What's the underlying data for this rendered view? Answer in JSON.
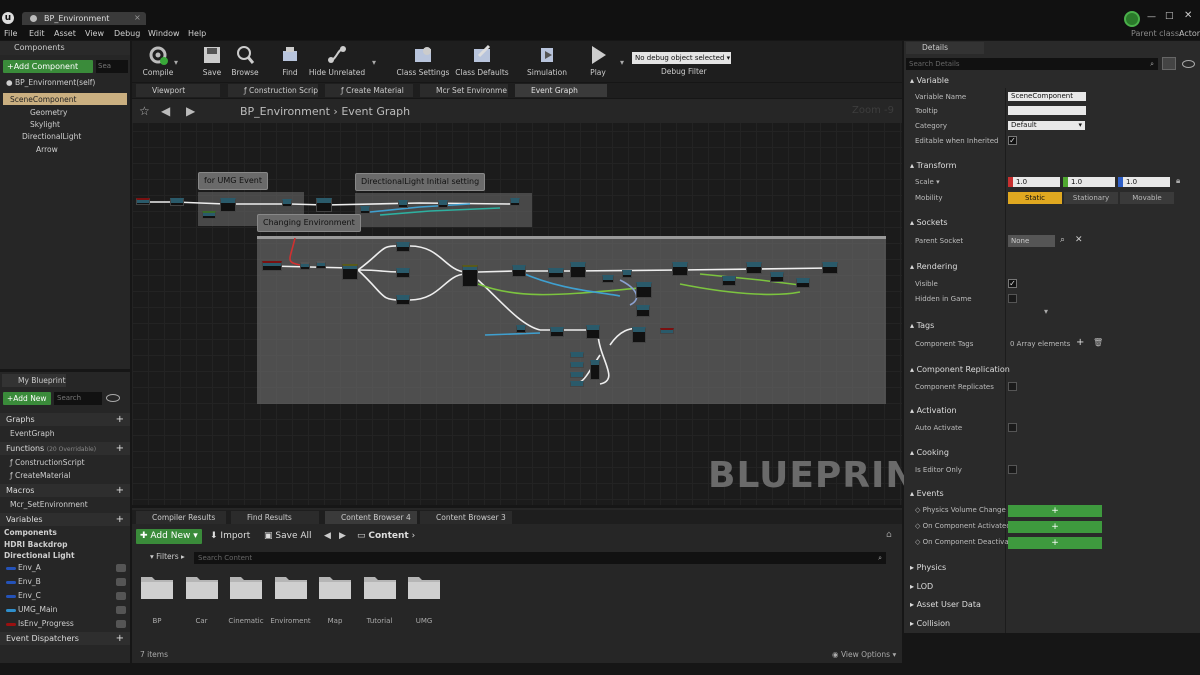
{
  "window": {
    "tab_title": "BP_Environment",
    "parent_class_label": "Parent class:",
    "parent_class_value": "Actor"
  },
  "menu": [
    "File",
    "Edit",
    "Asset",
    "View",
    "Debug",
    "Window",
    "Help"
  ],
  "toolbar": {
    "compile": "Compile",
    "save": "Save",
    "browse": "Browse",
    "find": "Find",
    "hide_unrelated": "Hide Unrelated",
    "class_settings": "Class Settings",
    "class_defaults": "Class Defaults",
    "simulation": "Simulation",
    "play": "Play",
    "debug_select": "No debug object selected",
    "debug_filter": "Debug Filter"
  },
  "components": {
    "header": "Components",
    "add_component": "+Add Component",
    "search_placeholder": "Sea",
    "self_item": "BP_Environment(self)",
    "tree": [
      "SceneComponent",
      "Geometry",
      "Skylight",
      "DirectionalLight",
      "Arrow"
    ]
  },
  "my_blueprint": {
    "header": "My Blueprint",
    "add_new": "+Add New",
    "search_placeholder": "Search",
    "graphs_label": "Graphs",
    "event_graph": "EventGraph",
    "functions_label": "Functions",
    "functions_note": "(20 Overridable)",
    "functions": [
      "ConstructionScript",
      "CreateMaterial"
    ],
    "macros_label": "Macros",
    "macros": [
      "Mcr_SetEnvironment"
    ],
    "variables_label": "Variables",
    "var_groups": [
      "Components",
      "HDRI Backdrop",
      "Directional Light"
    ],
    "variables": [
      {
        "name": "Env_A",
        "color": "#2452b8"
      },
      {
        "name": "Env_B",
        "color": "#2452b8"
      },
      {
        "name": "Env_C",
        "color": "#2452b8"
      },
      {
        "name": "UMG_Main",
        "color": "#2f8fcc"
      },
      {
        "name": "IsEnv_Progress",
        "color": "#9a1010"
      }
    ],
    "dispatchers_label": "Event Dispatchers"
  },
  "editor_tabs": [
    "Viewport",
    "Construction Scrip",
    "Create Material",
    "Mcr Set Environme",
    "Event Graph"
  ],
  "graph": {
    "breadcrumb_root": "BP_Environment",
    "breadcrumb_leaf": "Event Graph",
    "zoom": "Zoom -9",
    "watermark": "BLUEPRINT",
    "comments": [
      "for UMG Event",
      "DirectionalLight Initial setting",
      "Changing Environment"
    ]
  },
  "bottom": {
    "tabs": [
      "Compiler Results",
      "Find Results",
      "Content Browser 4",
      "Content Browser 3"
    ],
    "add_new": "Add New",
    "import": "Import",
    "save_all": "Save All",
    "content_path": "Content",
    "filters": "Filters",
    "search_placeholder": "Search Content",
    "folders": [
      "BP",
      "Car",
      "Cinematic",
      "Enviroment",
      "Map",
      "Tutorial",
      "UMG"
    ],
    "item_count": "7 items",
    "view_options": "View Options"
  },
  "details": {
    "header": "Details",
    "search_placeholder": "Search Details",
    "variable_section": "Variable",
    "variable_name_label": "Variable Name",
    "variable_name": "SceneComponent",
    "tooltip_label": "Tooltip",
    "category_label": "Category",
    "category": "Default",
    "editable_label": "Editable when Inherited",
    "transform_section": "Transform",
    "scale_label": "Scale",
    "scale_x": "1.0",
    "scale_y": "1.0",
    "scale_z": "1.0",
    "mobility_label": "Mobility",
    "mob_static": "Static",
    "mob_stationary": "Stationary",
    "mob_movable": "Movable",
    "sockets_section": "Sockets",
    "parent_socket_label": "Parent Socket",
    "parent_socket": "None",
    "rendering_section": "Rendering",
    "visible_label": "Visible",
    "hidden_label": "Hidden in Game",
    "tags_section": "Tags",
    "component_tags_label": "Component Tags",
    "array_count": "0 Array elements",
    "replication_section": "Component Replication",
    "replicates_label": "Component Replicates",
    "activation_section": "Activation",
    "auto_activate_label": "Auto Activate",
    "cooking_section": "Cooking",
    "editor_only_label": "Is Editor Only",
    "events_section": "Events",
    "events": [
      "Physics Volume Change",
      "On Component Activated",
      "On Component Deactiva"
    ],
    "collapsed": [
      "Physics",
      "LOD",
      "Asset User Data",
      "Collision"
    ]
  }
}
